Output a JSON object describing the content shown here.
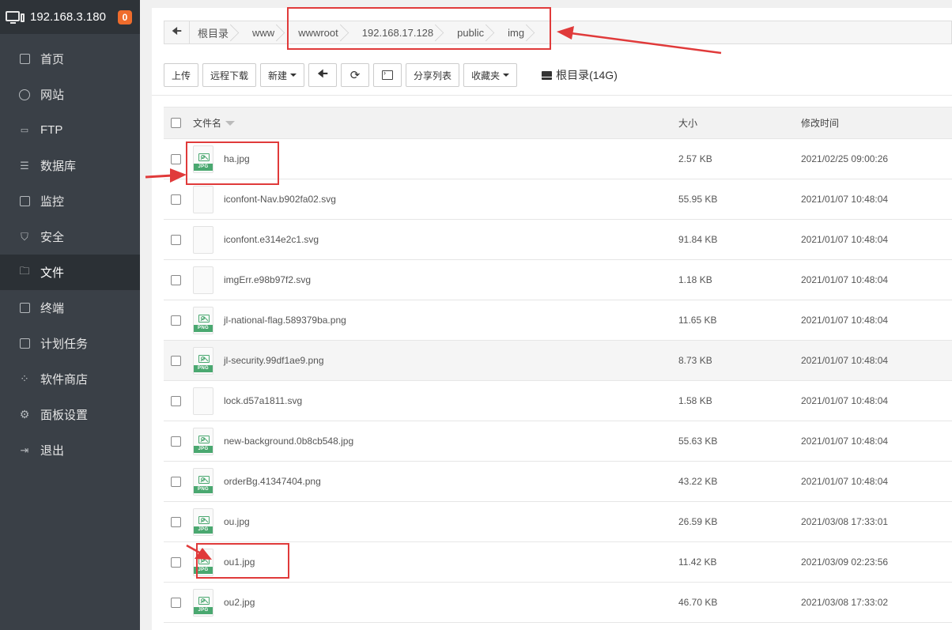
{
  "sidebar": {
    "host": "192.168.3.180",
    "badge": "0",
    "items": [
      {
        "label": "首页",
        "icon": "home-icon"
      },
      {
        "label": "网站",
        "icon": "globe-icon"
      },
      {
        "label": "FTP",
        "icon": "ftp-icon"
      },
      {
        "label": "数据库",
        "icon": "database-icon"
      },
      {
        "label": "监控",
        "icon": "monitor-icon"
      },
      {
        "label": "安全",
        "icon": "shield-icon"
      },
      {
        "label": "文件",
        "icon": "folder-icon"
      },
      {
        "label": "终端",
        "icon": "terminal-icon"
      },
      {
        "label": "计划任务",
        "icon": "calendar-icon"
      },
      {
        "label": "软件商店",
        "icon": "grid-icon"
      },
      {
        "label": "面板设置",
        "icon": "gear-icon"
      },
      {
        "label": "退出",
        "icon": "logout-icon"
      }
    ],
    "active": "文件"
  },
  "breadcrumb": [
    "根目录",
    "www",
    "wwwroot",
    "192.168.17.128",
    "public",
    "img"
  ],
  "toolbar": {
    "upload": "上传",
    "remote_download": "远程下载",
    "new": "新建",
    "share_list": "分享列表",
    "favorites": "收藏夹",
    "disk": "根目录(14G)"
  },
  "table": {
    "headers": {
      "name": "文件名",
      "size": "大小",
      "mtime": "修改时间"
    },
    "rows": [
      {
        "name": "ha.jpg",
        "type": "JPG",
        "size": "2.57 KB",
        "mtime": "2021/02/25 09:00:26"
      },
      {
        "name": "iconfont-Nav.b902fa02.svg",
        "type": "",
        "size": "55.95 KB",
        "mtime": "2021/01/07 10:48:04"
      },
      {
        "name": "iconfont.e314e2c1.svg",
        "type": "",
        "size": "91.84 KB",
        "mtime": "2021/01/07 10:48:04"
      },
      {
        "name": "imgErr.e98b97f2.svg",
        "type": "",
        "size": "1.18 KB",
        "mtime": "2021/01/07 10:48:04"
      },
      {
        "name": "jl-national-flag.589379ba.png",
        "type": "PNG",
        "size": "11.65 KB",
        "mtime": "2021/01/07 10:48:04"
      },
      {
        "name": "jl-security.99df1ae9.png",
        "type": "PNG",
        "size": "8.73 KB",
        "mtime": "2021/01/07 10:48:04"
      },
      {
        "name": "lock.d57a1811.svg",
        "type": "",
        "size": "1.58 KB",
        "mtime": "2021/01/07 10:48:04"
      },
      {
        "name": "new-background.0b8cb548.jpg",
        "type": "JPG",
        "size": "55.63 KB",
        "mtime": "2021/01/07 10:48:04"
      },
      {
        "name": "orderBg.41347404.png",
        "type": "PNG",
        "size": "43.22 KB",
        "mtime": "2021/01/07 10:48:04"
      },
      {
        "name": "ou.jpg",
        "type": "JPG",
        "size": "26.59 KB",
        "mtime": "2021/03/08 17:33:01"
      },
      {
        "name": "ou1.jpg",
        "type": "JPG",
        "size": "11.42 KB",
        "mtime": "2021/03/09 02:23:56"
      },
      {
        "name": "ou2.jpg",
        "type": "JPG",
        "size": "46.70 KB",
        "mtime": "2021/03/08 17:33:02"
      }
    ]
  },
  "colors": {
    "sidebar_bg": "#3a4047",
    "annotation_red": "#e03a3a",
    "image_icon_green": "#4aa870",
    "badge_orange": "#ef6c2c"
  }
}
